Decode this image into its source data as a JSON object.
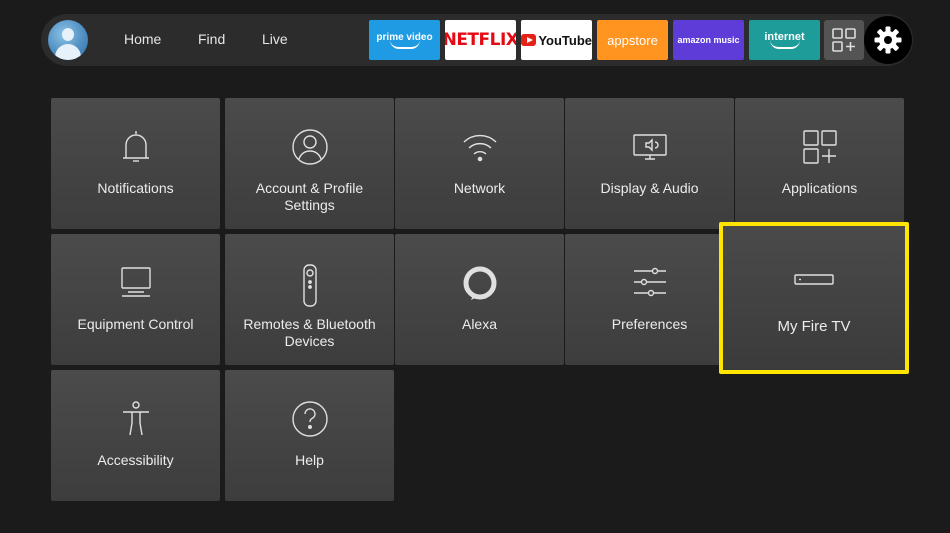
{
  "topbar": {
    "nav": [
      "Home",
      "Find",
      "Live"
    ],
    "apps": [
      "prime video",
      "NETFLIX",
      "YouTube",
      "appstore",
      "amazon music",
      "internet"
    ],
    "all_apps_icon": "grid-plus-icon",
    "settings_icon": "gear-icon"
  },
  "settings": [
    {
      "label": "Notifications",
      "icon": "bell-icon"
    },
    {
      "label": "Account & Profile Settings",
      "icon": "user-icon"
    },
    {
      "label": "Network",
      "icon": "wifi-icon"
    },
    {
      "label": "Display & Audio",
      "icon": "monitor-icon"
    },
    {
      "label": "Applications",
      "icon": "apps-grid-icon"
    },
    {
      "label": "Equipment Control",
      "icon": "tv-icon"
    },
    {
      "label": "Remotes & Bluetooth Devices",
      "icon": "remote-icon"
    },
    {
      "label": "Alexa",
      "icon": "alexa-ring-icon"
    },
    {
      "label": "Preferences",
      "icon": "sliders-icon"
    },
    {
      "label": "My Fire TV",
      "icon": "fire-tv-stick-icon"
    },
    {
      "label": "Accessibility",
      "icon": "accessibility-icon"
    },
    {
      "label": "Help",
      "icon": "help-icon"
    }
  ],
  "focused_item": "My Fire TV",
  "colors": {
    "focus": "#ffe500",
    "tile": "#444444",
    "background": "#1b1b1b"
  }
}
